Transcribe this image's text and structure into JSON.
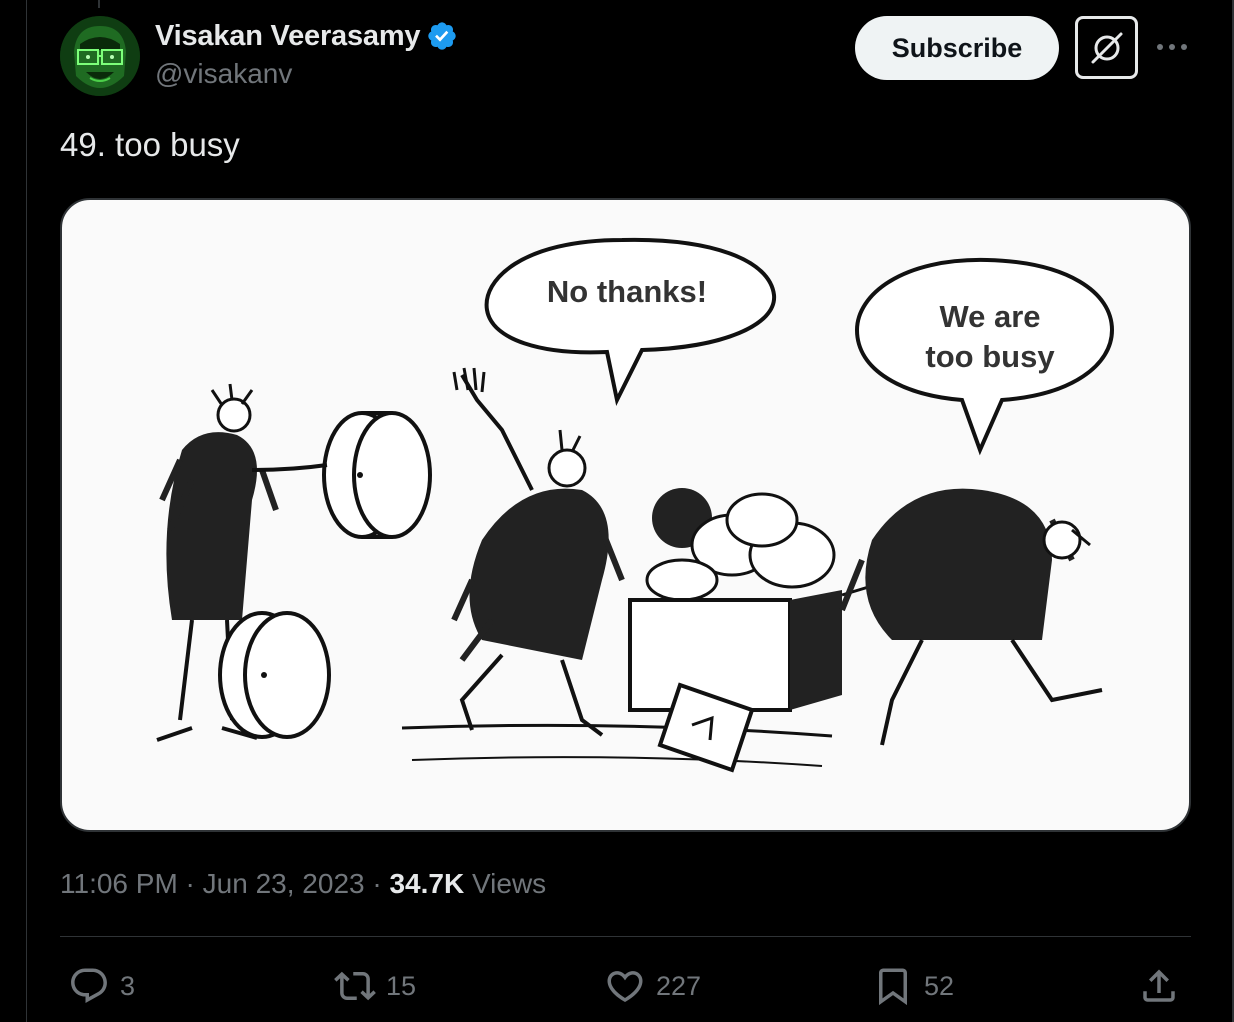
{
  "author": {
    "name": "Visakan Veerasamy",
    "handle": "@visakanv",
    "verified_badge_icon": "verified-badge-icon"
  },
  "header_actions": {
    "subscribe_label": "Subscribe",
    "grok_icon": "grok-icon",
    "more_icon": "more-icon"
  },
  "tweet": {
    "text": "49. too busy",
    "image": {
      "bubble_left": "No thanks!",
      "bubble_right_line1": "We are",
      "bubble_right_line2": "too busy"
    },
    "time": "11:06 PM",
    "separator": " · ",
    "date": "Jun 23, 2023",
    "views_count": "34.7K",
    "views_label": " Views"
  },
  "actions": {
    "replies": "3",
    "reposts": "15",
    "likes": "227",
    "bookmarks": "52"
  },
  "colors": {
    "background": "#000000",
    "text_primary": "#e7e9ea",
    "text_secondary": "#71767b",
    "verified": "#1d9bf0",
    "divider": "#2f3336"
  }
}
